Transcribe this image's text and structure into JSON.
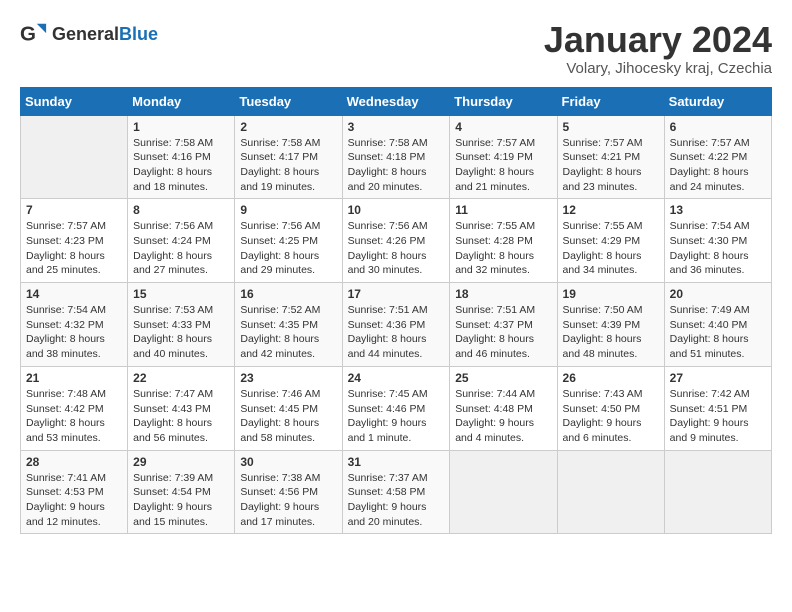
{
  "header": {
    "logo_general": "General",
    "logo_blue": "Blue",
    "month_title": "January 2024",
    "location": "Volary, Jihocesky kraj, Czechia"
  },
  "days_of_week": [
    "Sunday",
    "Monday",
    "Tuesday",
    "Wednesday",
    "Thursday",
    "Friday",
    "Saturday"
  ],
  "weeks": [
    [
      {
        "day": "",
        "info": ""
      },
      {
        "day": "1",
        "info": "Sunrise: 7:58 AM\nSunset: 4:16 PM\nDaylight: 8 hours\nand 18 minutes."
      },
      {
        "day": "2",
        "info": "Sunrise: 7:58 AM\nSunset: 4:17 PM\nDaylight: 8 hours\nand 19 minutes."
      },
      {
        "day": "3",
        "info": "Sunrise: 7:58 AM\nSunset: 4:18 PM\nDaylight: 8 hours\nand 20 minutes."
      },
      {
        "day": "4",
        "info": "Sunrise: 7:57 AM\nSunset: 4:19 PM\nDaylight: 8 hours\nand 21 minutes."
      },
      {
        "day": "5",
        "info": "Sunrise: 7:57 AM\nSunset: 4:21 PM\nDaylight: 8 hours\nand 23 minutes."
      },
      {
        "day": "6",
        "info": "Sunrise: 7:57 AM\nSunset: 4:22 PM\nDaylight: 8 hours\nand 24 minutes."
      }
    ],
    [
      {
        "day": "7",
        "info": "Sunrise: 7:57 AM\nSunset: 4:23 PM\nDaylight: 8 hours\nand 25 minutes."
      },
      {
        "day": "8",
        "info": "Sunrise: 7:56 AM\nSunset: 4:24 PM\nDaylight: 8 hours\nand 27 minutes."
      },
      {
        "day": "9",
        "info": "Sunrise: 7:56 AM\nSunset: 4:25 PM\nDaylight: 8 hours\nand 29 minutes."
      },
      {
        "day": "10",
        "info": "Sunrise: 7:56 AM\nSunset: 4:26 PM\nDaylight: 8 hours\nand 30 minutes."
      },
      {
        "day": "11",
        "info": "Sunrise: 7:55 AM\nSunset: 4:28 PM\nDaylight: 8 hours\nand 32 minutes."
      },
      {
        "day": "12",
        "info": "Sunrise: 7:55 AM\nSunset: 4:29 PM\nDaylight: 8 hours\nand 34 minutes."
      },
      {
        "day": "13",
        "info": "Sunrise: 7:54 AM\nSunset: 4:30 PM\nDaylight: 8 hours\nand 36 minutes."
      }
    ],
    [
      {
        "day": "14",
        "info": "Sunrise: 7:54 AM\nSunset: 4:32 PM\nDaylight: 8 hours\nand 38 minutes."
      },
      {
        "day": "15",
        "info": "Sunrise: 7:53 AM\nSunset: 4:33 PM\nDaylight: 8 hours\nand 40 minutes."
      },
      {
        "day": "16",
        "info": "Sunrise: 7:52 AM\nSunset: 4:35 PM\nDaylight: 8 hours\nand 42 minutes."
      },
      {
        "day": "17",
        "info": "Sunrise: 7:51 AM\nSunset: 4:36 PM\nDaylight: 8 hours\nand 44 minutes."
      },
      {
        "day": "18",
        "info": "Sunrise: 7:51 AM\nSunset: 4:37 PM\nDaylight: 8 hours\nand 46 minutes."
      },
      {
        "day": "19",
        "info": "Sunrise: 7:50 AM\nSunset: 4:39 PM\nDaylight: 8 hours\nand 48 minutes."
      },
      {
        "day": "20",
        "info": "Sunrise: 7:49 AM\nSunset: 4:40 PM\nDaylight: 8 hours\nand 51 minutes."
      }
    ],
    [
      {
        "day": "21",
        "info": "Sunrise: 7:48 AM\nSunset: 4:42 PM\nDaylight: 8 hours\nand 53 minutes."
      },
      {
        "day": "22",
        "info": "Sunrise: 7:47 AM\nSunset: 4:43 PM\nDaylight: 8 hours\nand 56 minutes."
      },
      {
        "day": "23",
        "info": "Sunrise: 7:46 AM\nSunset: 4:45 PM\nDaylight: 8 hours\nand 58 minutes."
      },
      {
        "day": "24",
        "info": "Sunrise: 7:45 AM\nSunset: 4:46 PM\nDaylight: 9 hours\nand 1 minute."
      },
      {
        "day": "25",
        "info": "Sunrise: 7:44 AM\nSunset: 4:48 PM\nDaylight: 9 hours\nand 4 minutes."
      },
      {
        "day": "26",
        "info": "Sunrise: 7:43 AM\nSunset: 4:50 PM\nDaylight: 9 hours\nand 6 minutes."
      },
      {
        "day": "27",
        "info": "Sunrise: 7:42 AM\nSunset: 4:51 PM\nDaylight: 9 hours\nand 9 minutes."
      }
    ],
    [
      {
        "day": "28",
        "info": "Sunrise: 7:41 AM\nSunset: 4:53 PM\nDaylight: 9 hours\nand 12 minutes."
      },
      {
        "day": "29",
        "info": "Sunrise: 7:39 AM\nSunset: 4:54 PM\nDaylight: 9 hours\nand 15 minutes."
      },
      {
        "day": "30",
        "info": "Sunrise: 7:38 AM\nSunset: 4:56 PM\nDaylight: 9 hours\nand 17 minutes."
      },
      {
        "day": "31",
        "info": "Sunrise: 7:37 AM\nSunset: 4:58 PM\nDaylight: 9 hours\nand 20 minutes."
      },
      {
        "day": "",
        "info": ""
      },
      {
        "day": "",
        "info": ""
      },
      {
        "day": "",
        "info": ""
      }
    ]
  ]
}
